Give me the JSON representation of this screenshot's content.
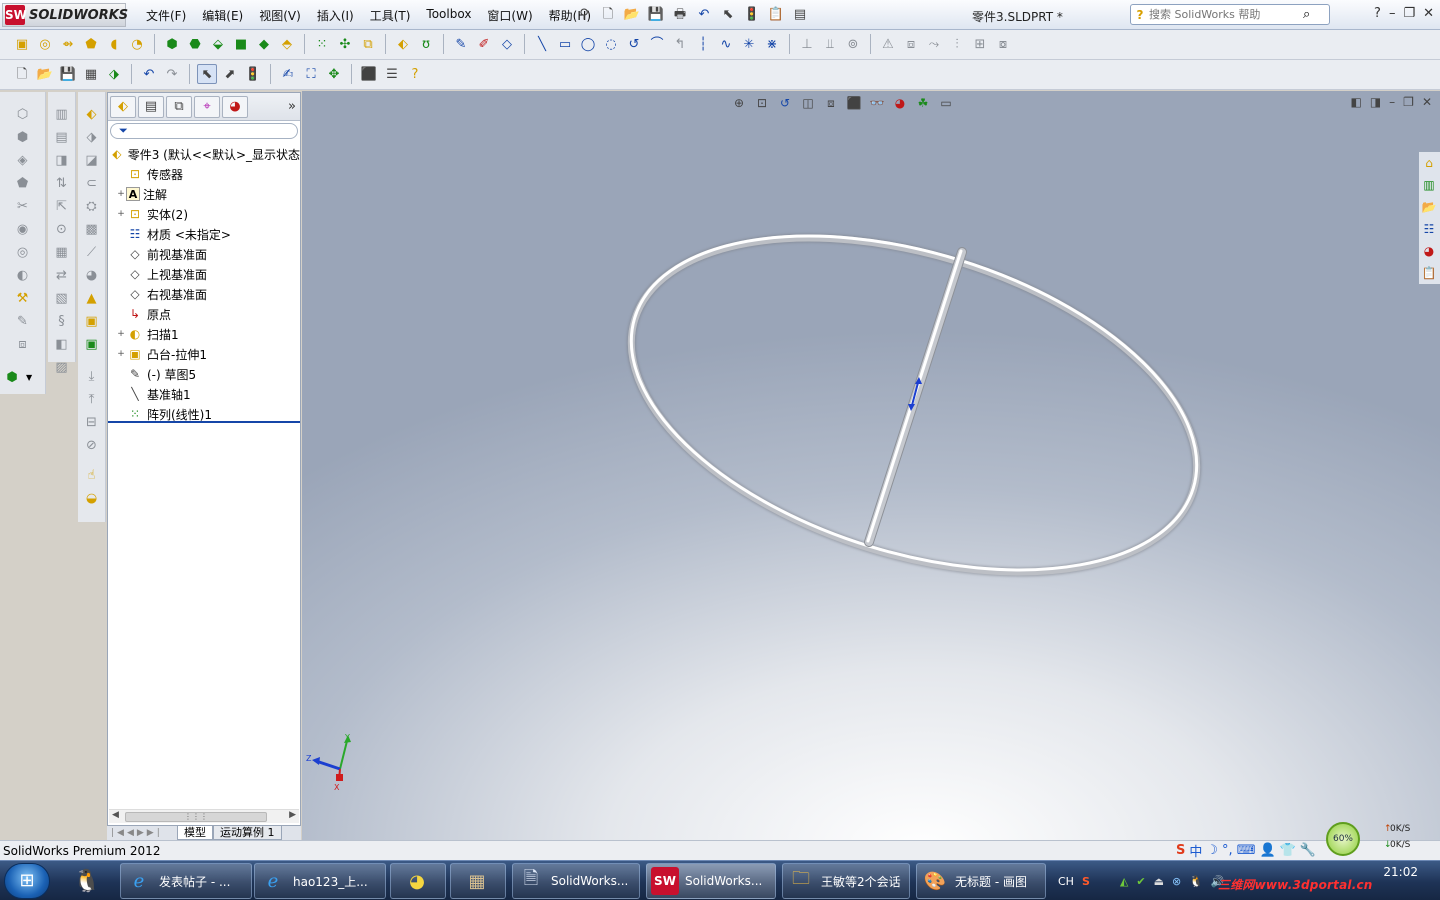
{
  "app": {
    "logo_text": "SOLIDWORKS",
    "logo_mark": "SW",
    "document_title": "零件3.SLDPRT *",
    "search_placeholder": "搜索 SolidWorks 帮助"
  },
  "menu": [
    "文件(F)",
    "编辑(E)",
    "视图(V)",
    "插入(I)",
    "工具(T)",
    "Toolbox",
    "窗口(W)",
    "帮助(H)"
  ],
  "feature_manager": {
    "filter_icon": "filter-icon",
    "more_label": "»",
    "tree": [
      {
        "label": "零件3 (默认<<默认>_显示状态",
        "icon": "part-icon",
        "level": "root",
        "expand": ""
      },
      {
        "label": "传感器",
        "icon": "sensor-icon",
        "level": "child",
        "expand": ""
      },
      {
        "label": "注解",
        "icon": "annotation-icon",
        "level": "child",
        "expand": "+"
      },
      {
        "label": "实体(2)",
        "icon": "solid-bodies-icon",
        "level": "child",
        "expand": "+"
      },
      {
        "label": "材质 <未指定>",
        "icon": "material-icon",
        "level": "child",
        "expand": ""
      },
      {
        "label": "前视基准面",
        "icon": "plane-icon",
        "level": "child",
        "expand": ""
      },
      {
        "label": "上视基准面",
        "icon": "plane-icon",
        "level": "child",
        "expand": ""
      },
      {
        "label": "右视基准面",
        "icon": "plane-icon",
        "level": "child",
        "expand": ""
      },
      {
        "label": "原点",
        "icon": "origin-icon",
        "level": "child",
        "expand": ""
      },
      {
        "label": "扫描1",
        "icon": "sweep-icon",
        "level": "child",
        "expand": "+"
      },
      {
        "label": "凸台-拉伸1",
        "icon": "boss-extrude-icon",
        "level": "child",
        "expand": "+"
      },
      {
        "label": "(-) 草图5",
        "icon": "sketch-icon",
        "level": "child",
        "expand": ""
      },
      {
        "label": "基准轴1",
        "icon": "axis-icon",
        "level": "child",
        "expand": ""
      },
      {
        "label": "阵列(线性)1",
        "icon": "linear-pattern-icon",
        "level": "child",
        "expand": ""
      }
    ],
    "bottom_tabs": [
      "模型",
      "运动算例 1"
    ]
  },
  "status": {
    "text": "SolidWorks Premium 2012",
    "ime_items": [
      "S",
      "中",
      "☽",
      "°,",
      "⌨",
      "👤",
      "👕",
      "🔧"
    ]
  },
  "net_monitor": {
    "percent": "60%",
    "up": "0K/S",
    "down": "0K/S"
  },
  "taskbar": {
    "buttons": [
      {
        "label": "发表帖子 - ...",
        "icon": "ie-icon"
      },
      {
        "label": "hao123_上...",
        "icon": "ie-icon"
      },
      {
        "label": "",
        "icon": "media-icon"
      },
      {
        "label": "",
        "icon": "film-icon"
      },
      {
        "label": "SolidWorks...",
        "icon": "word-icon"
      },
      {
        "label": "SolidWorks...",
        "icon": "solidworks-icon"
      },
      {
        "label": "王敏等2个会话",
        "icon": "qq-chat-icon"
      },
      {
        "label": "无标题 - 画图",
        "icon": "paint-icon"
      }
    ],
    "lang": "CH",
    "time": "21:02",
    "watermark": "三维网www.3dportal.cn"
  },
  "colors": {
    "tree_rollback_bar": "#1546a8",
    "logo_red": "#c8102e"
  }
}
